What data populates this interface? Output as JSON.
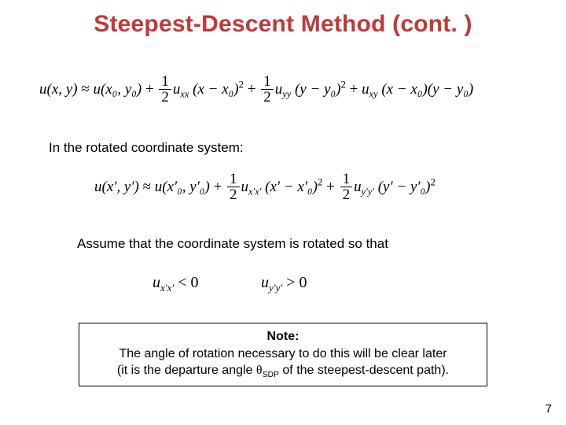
{
  "title": "Steepest-Descent Method (cont. )",
  "eq1_lhs": "u",
  "eq1_args": "(x, y)",
  "eq1_approx": " ≈ ",
  "eq1_rhs_u": "u",
  "eq1_rhs_args0": "(x₀, y₀)",
  "plus": " + ",
  "half_num": "1",
  "half_den": "2",
  "u_xx": "u",
  "u_xx_sub": "xx",
  "term_xx": " (x − x₀)",
  "sq": "2",
  "u_yy": "u",
  "u_yy_sub": "yy",
  "term_yy": " (y − y₀)",
  "u_xy": "u",
  "u_xy_sub": "xy",
  "term_xy_a": " (x − x₀)",
  "term_xy_b": "(y − y₀)",
  "txt1": "In the rotated coordinate system:",
  "eq2_lhs": "u",
  "eq2_args": "(x′, y′)",
  "eq2_rhs_args0": "(x′₀, y′₀)",
  "u_xxp_sub": "x′x′",
  "term_xxp": " (x′ − x′₀)",
  "u_yyp_sub": "y′y′",
  "term_yyp": " (y′ − y′₀)",
  "txt2": "Assume that the coordinate system is rotated so that",
  "cond1_u": "u",
  "cond1_sub": "x′x′",
  "cond1_op": " < 0",
  "cond2_u": "u",
  "cond2_sub": "y′y′",
  "cond2_op": " > 0",
  "note_title": "Note:",
  "note_line1": "The angle of rotation necessary to do this will be clear later",
  "note_line2a": "(it is the departure angle ",
  "note_theta": "θ",
  "note_sdp": "SDP",
  "note_line2b": " of the steepest-descent path).",
  "page": "7"
}
